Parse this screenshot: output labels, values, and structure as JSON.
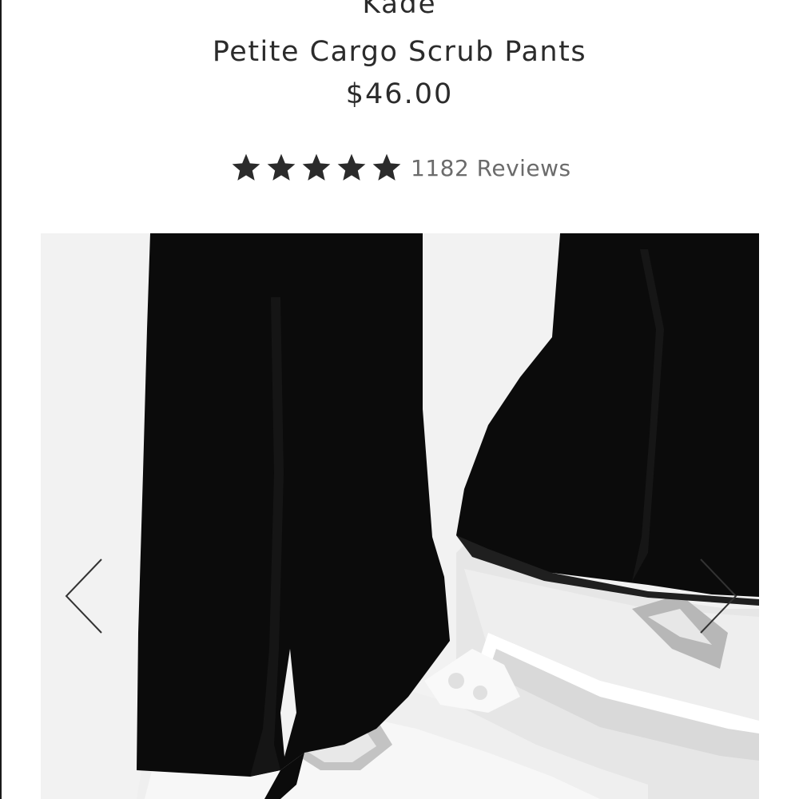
{
  "product": {
    "brand": "Kade",
    "name": "Petite Cargo Scrub Pants",
    "price": "$46.00"
  },
  "rating": {
    "stars": 5,
    "max_stars": 5,
    "reviews_label": "1182 Reviews"
  },
  "gallery": {
    "image": "product-photo-black-scrub-pants-white-sneakers",
    "prev_icon": "chevron-left-icon",
    "next_icon": "chevron-right-icon"
  },
  "colors": {
    "text": "#2b2b2b",
    "muted_text": "#6b6b6b",
    "star": "#2b2b2b",
    "gallery_bg": "#f2f2f2"
  }
}
